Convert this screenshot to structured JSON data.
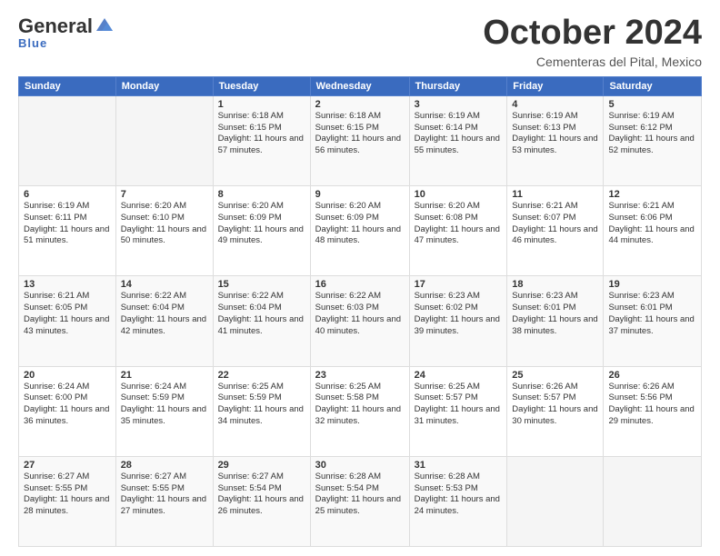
{
  "logo": {
    "general": "General",
    "blue": "Blue",
    "tagline": "Blue"
  },
  "title": "October 2024",
  "subtitle": "Cementeras del Pital, Mexico",
  "days_header": [
    "Sunday",
    "Monday",
    "Tuesday",
    "Wednesday",
    "Thursday",
    "Friday",
    "Saturday"
  ],
  "weeks": [
    [
      {
        "day": "",
        "sunrise": "",
        "sunset": "",
        "daylight": ""
      },
      {
        "day": "",
        "sunrise": "",
        "sunset": "",
        "daylight": ""
      },
      {
        "day": "1",
        "sunrise": "Sunrise: 6:18 AM",
        "sunset": "Sunset: 6:15 PM",
        "daylight": "Daylight: 11 hours and 57 minutes."
      },
      {
        "day": "2",
        "sunrise": "Sunrise: 6:18 AM",
        "sunset": "Sunset: 6:15 PM",
        "daylight": "Daylight: 11 hours and 56 minutes."
      },
      {
        "day": "3",
        "sunrise": "Sunrise: 6:19 AM",
        "sunset": "Sunset: 6:14 PM",
        "daylight": "Daylight: 11 hours and 55 minutes."
      },
      {
        "day": "4",
        "sunrise": "Sunrise: 6:19 AM",
        "sunset": "Sunset: 6:13 PM",
        "daylight": "Daylight: 11 hours and 53 minutes."
      },
      {
        "day": "5",
        "sunrise": "Sunrise: 6:19 AM",
        "sunset": "Sunset: 6:12 PM",
        "daylight": "Daylight: 11 hours and 52 minutes."
      }
    ],
    [
      {
        "day": "6",
        "sunrise": "Sunrise: 6:19 AM",
        "sunset": "Sunset: 6:11 PM",
        "daylight": "Daylight: 11 hours and 51 minutes."
      },
      {
        "day": "7",
        "sunrise": "Sunrise: 6:20 AM",
        "sunset": "Sunset: 6:10 PM",
        "daylight": "Daylight: 11 hours and 50 minutes."
      },
      {
        "day": "8",
        "sunrise": "Sunrise: 6:20 AM",
        "sunset": "Sunset: 6:09 PM",
        "daylight": "Daylight: 11 hours and 49 minutes."
      },
      {
        "day": "9",
        "sunrise": "Sunrise: 6:20 AM",
        "sunset": "Sunset: 6:09 PM",
        "daylight": "Daylight: 11 hours and 48 minutes."
      },
      {
        "day": "10",
        "sunrise": "Sunrise: 6:20 AM",
        "sunset": "Sunset: 6:08 PM",
        "daylight": "Daylight: 11 hours and 47 minutes."
      },
      {
        "day": "11",
        "sunrise": "Sunrise: 6:21 AM",
        "sunset": "Sunset: 6:07 PM",
        "daylight": "Daylight: 11 hours and 46 minutes."
      },
      {
        "day": "12",
        "sunrise": "Sunrise: 6:21 AM",
        "sunset": "Sunset: 6:06 PM",
        "daylight": "Daylight: 11 hours and 44 minutes."
      }
    ],
    [
      {
        "day": "13",
        "sunrise": "Sunrise: 6:21 AM",
        "sunset": "Sunset: 6:05 PM",
        "daylight": "Daylight: 11 hours and 43 minutes."
      },
      {
        "day": "14",
        "sunrise": "Sunrise: 6:22 AM",
        "sunset": "Sunset: 6:04 PM",
        "daylight": "Daylight: 11 hours and 42 minutes."
      },
      {
        "day": "15",
        "sunrise": "Sunrise: 6:22 AM",
        "sunset": "Sunset: 6:04 PM",
        "daylight": "Daylight: 11 hours and 41 minutes."
      },
      {
        "day": "16",
        "sunrise": "Sunrise: 6:22 AM",
        "sunset": "Sunset: 6:03 PM",
        "daylight": "Daylight: 11 hours and 40 minutes."
      },
      {
        "day": "17",
        "sunrise": "Sunrise: 6:23 AM",
        "sunset": "Sunset: 6:02 PM",
        "daylight": "Daylight: 11 hours and 39 minutes."
      },
      {
        "day": "18",
        "sunrise": "Sunrise: 6:23 AM",
        "sunset": "Sunset: 6:01 PM",
        "daylight": "Daylight: 11 hours and 38 minutes."
      },
      {
        "day": "19",
        "sunrise": "Sunrise: 6:23 AM",
        "sunset": "Sunset: 6:01 PM",
        "daylight": "Daylight: 11 hours and 37 minutes."
      }
    ],
    [
      {
        "day": "20",
        "sunrise": "Sunrise: 6:24 AM",
        "sunset": "Sunset: 6:00 PM",
        "daylight": "Daylight: 11 hours and 36 minutes."
      },
      {
        "day": "21",
        "sunrise": "Sunrise: 6:24 AM",
        "sunset": "Sunset: 5:59 PM",
        "daylight": "Daylight: 11 hours and 35 minutes."
      },
      {
        "day": "22",
        "sunrise": "Sunrise: 6:25 AM",
        "sunset": "Sunset: 5:59 PM",
        "daylight": "Daylight: 11 hours and 34 minutes."
      },
      {
        "day": "23",
        "sunrise": "Sunrise: 6:25 AM",
        "sunset": "Sunset: 5:58 PM",
        "daylight": "Daylight: 11 hours and 32 minutes."
      },
      {
        "day": "24",
        "sunrise": "Sunrise: 6:25 AM",
        "sunset": "Sunset: 5:57 PM",
        "daylight": "Daylight: 11 hours and 31 minutes."
      },
      {
        "day": "25",
        "sunrise": "Sunrise: 6:26 AM",
        "sunset": "Sunset: 5:57 PM",
        "daylight": "Daylight: 11 hours and 30 minutes."
      },
      {
        "day": "26",
        "sunrise": "Sunrise: 6:26 AM",
        "sunset": "Sunset: 5:56 PM",
        "daylight": "Daylight: 11 hours and 29 minutes."
      }
    ],
    [
      {
        "day": "27",
        "sunrise": "Sunrise: 6:27 AM",
        "sunset": "Sunset: 5:55 PM",
        "daylight": "Daylight: 11 hours and 28 minutes."
      },
      {
        "day": "28",
        "sunrise": "Sunrise: 6:27 AM",
        "sunset": "Sunset: 5:55 PM",
        "daylight": "Daylight: 11 hours and 27 minutes."
      },
      {
        "day": "29",
        "sunrise": "Sunrise: 6:27 AM",
        "sunset": "Sunset: 5:54 PM",
        "daylight": "Daylight: 11 hours and 26 minutes."
      },
      {
        "day": "30",
        "sunrise": "Sunrise: 6:28 AM",
        "sunset": "Sunset: 5:54 PM",
        "daylight": "Daylight: 11 hours and 25 minutes."
      },
      {
        "day": "31",
        "sunrise": "Sunrise: 6:28 AM",
        "sunset": "Sunset: 5:53 PM",
        "daylight": "Daylight: 11 hours and 24 minutes."
      },
      {
        "day": "",
        "sunrise": "",
        "sunset": "",
        "daylight": ""
      },
      {
        "day": "",
        "sunrise": "",
        "sunset": "",
        "daylight": ""
      }
    ]
  ]
}
